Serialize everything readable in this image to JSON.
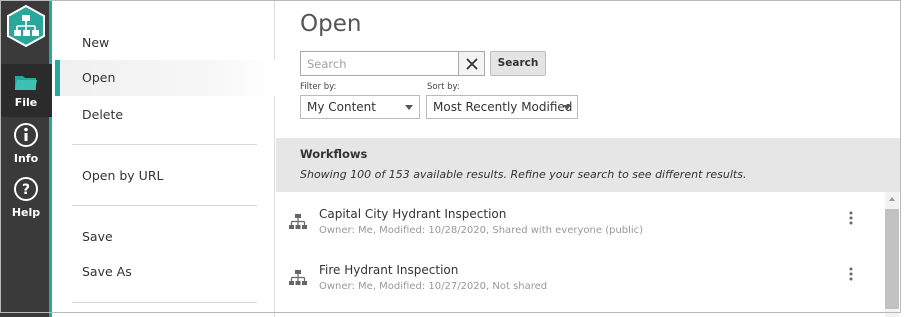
{
  "rail": {
    "items": [
      {
        "label": "File",
        "icon": "folder-icon"
      },
      {
        "label": "Info",
        "icon": "info-icon"
      },
      {
        "label": "Help",
        "icon": "help-icon"
      }
    ],
    "accent": "#2aa79b"
  },
  "menu": {
    "items": [
      {
        "label": "New"
      },
      {
        "label": "Open"
      },
      {
        "label": "Delete"
      },
      {
        "label": "Open by URL"
      },
      {
        "label": "Save"
      },
      {
        "label": "Save As"
      }
    ]
  },
  "main": {
    "title": "Open",
    "search": {
      "placeholder": "Search",
      "clear_icon": "close-icon",
      "button_label": "Search"
    },
    "filter": {
      "label": "Filter by:",
      "value": "My Content"
    },
    "sort": {
      "label": "Sort by:",
      "value": "Most Recently Modified"
    },
    "results": {
      "heading": "Workflows",
      "summary": "Showing 100 of 153 available results. Refine your search to see different results."
    },
    "rows": [
      {
        "name": "Capital City Hydrant Inspection",
        "meta": "Owner: Me, Modified: 10/28/2020, Shared with everyone (public)",
        "icon": "workflow-icon"
      },
      {
        "name": "Fire Hydrant Inspection",
        "meta": "Owner: Me, Modified: 10/27/2020, Not shared",
        "icon": "workflow-icon"
      }
    ]
  }
}
